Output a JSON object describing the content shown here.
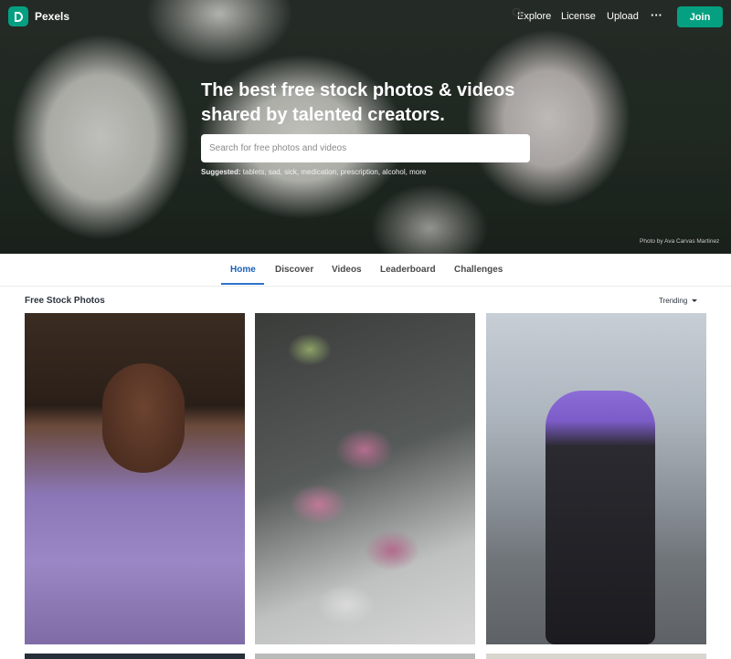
{
  "brand": {
    "name": "Pexels",
    "accent_color": "#05a081"
  },
  "nav": {
    "explore": "Explore",
    "license": "License",
    "upload": "Upload",
    "more": "···",
    "join": "Join"
  },
  "hero": {
    "headline_line1": "The best free stock photos & videos",
    "headline_line2": "shared by talented creators.",
    "search_placeholder": "Search for free photos and videos",
    "suggested_label": "Suggested:",
    "suggested_terms": "tablets, sad, sick, medication, prescription, alcohol, more",
    "photo_credit": "Photo by Ava Carvas Martinez"
  },
  "tabs": [
    {
      "label": "Home",
      "active": true
    },
    {
      "label": "Discover",
      "active": false
    },
    {
      "label": "Videos",
      "active": false
    },
    {
      "label": "Leaderboard",
      "active": false
    },
    {
      "label": "Challenges",
      "active": false
    }
  ],
  "section": {
    "title": "Free Stock Photos",
    "sort_selected": "Trending"
  },
  "photos": [
    {
      "icon": "photo-woman-lavender-hoodie"
    },
    {
      "icon": "photo-flower-shelves"
    },
    {
      "icon": "photo-woman-purple-hair"
    }
  ],
  "colors": {
    "active_tab": "#1b60b8",
    "tab_underline": "#2f73c9"
  }
}
